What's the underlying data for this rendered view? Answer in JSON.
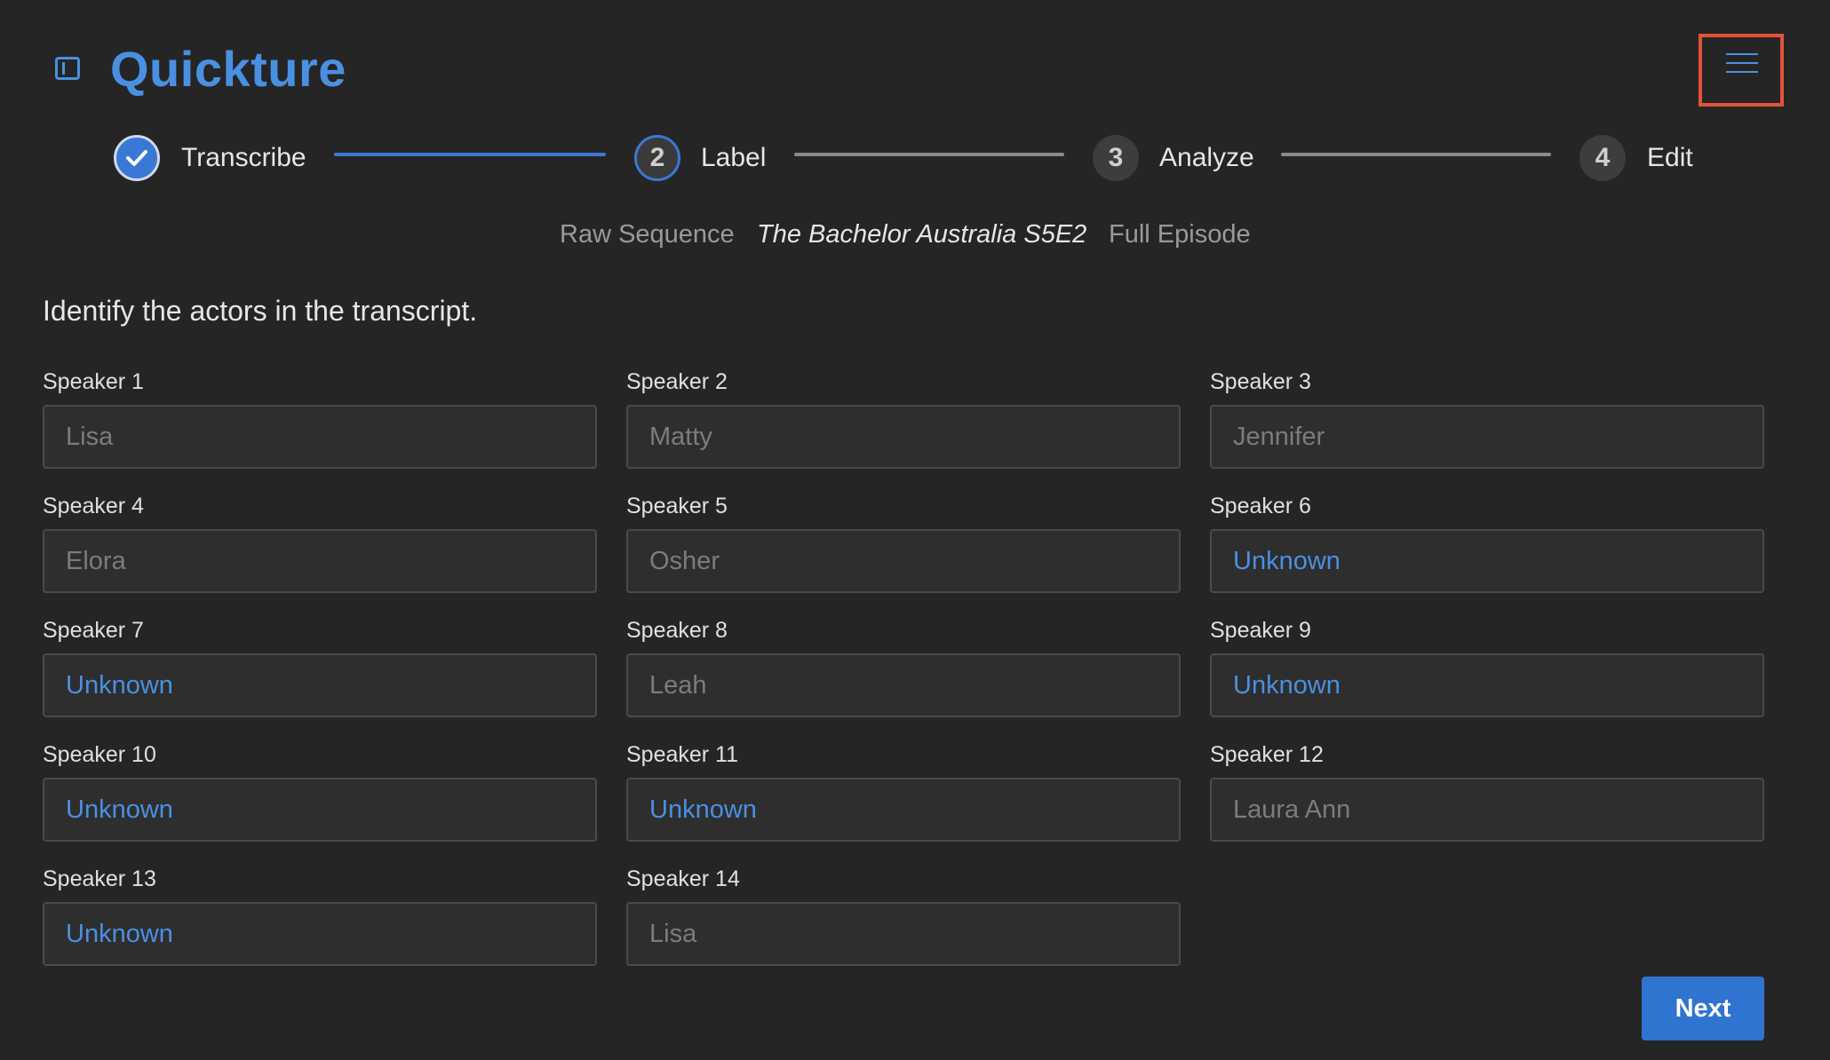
{
  "header": {
    "title": "Quickture",
    "sidebar_toggle_icon": "sidebar-icon",
    "menu_icon": "hamburger-menu-icon"
  },
  "stepper": {
    "steps": [
      {
        "number": "",
        "label": "Transcribe",
        "state": "done"
      },
      {
        "number": "2",
        "label": "Label",
        "state": "active"
      },
      {
        "number": "3",
        "label": "Analyze",
        "state": "todo"
      },
      {
        "number": "4",
        "label": "Edit",
        "state": "todo"
      }
    ]
  },
  "meta": {
    "sequence": "Raw Sequence",
    "episode": "The Bachelor Australia S5E2",
    "type": "Full Episode"
  },
  "instruction": "Identify the actors in the transcript.",
  "speakers": [
    {
      "label": "Speaker 1",
      "placeholder": "Lisa"
    },
    {
      "label": "Speaker 2",
      "placeholder": "Matty"
    },
    {
      "label": "Speaker 3",
      "placeholder": "Jennifer"
    },
    {
      "label": "Speaker 4",
      "placeholder": "Elora"
    },
    {
      "label": "Speaker 5",
      "placeholder": "Osher"
    },
    {
      "label": "Speaker 6",
      "placeholder": "Unknown"
    },
    {
      "label": "Speaker 7",
      "placeholder": "Unknown"
    },
    {
      "label": "Speaker 8",
      "placeholder": "Leah"
    },
    {
      "label": "Speaker 9",
      "placeholder": "Unknown"
    },
    {
      "label": "Speaker 10",
      "placeholder": "Unknown"
    },
    {
      "label": "Speaker 11",
      "placeholder": "Unknown"
    },
    {
      "label": "Speaker 12",
      "placeholder": "Laura Ann"
    },
    {
      "label": "Speaker 13",
      "placeholder": "Unknown"
    },
    {
      "label": "Speaker 14",
      "placeholder": "Lisa"
    }
  ],
  "actions": {
    "next_label": "Next"
  },
  "colors": {
    "accent": "#4a90e2",
    "background": "#252525",
    "highlight_border": "#e0533a"
  }
}
